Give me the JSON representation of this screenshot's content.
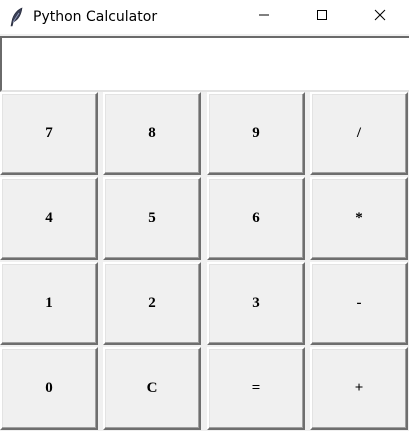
{
  "window": {
    "title": "Python Calculator",
    "app_icon": "feather-icon",
    "controls": {
      "minimize_icon": "minimize-icon",
      "maximize_icon": "maximize-icon",
      "close_icon": "close-icon"
    }
  },
  "display": {
    "value": ""
  },
  "keys": {
    "row1": [
      "7",
      "8",
      "9",
      "/"
    ],
    "row2": [
      "4",
      "5",
      "6",
      "*"
    ],
    "row3": [
      "1",
      "2",
      "3",
      "-"
    ],
    "row4": [
      "0",
      "C",
      "=",
      "+"
    ]
  }
}
